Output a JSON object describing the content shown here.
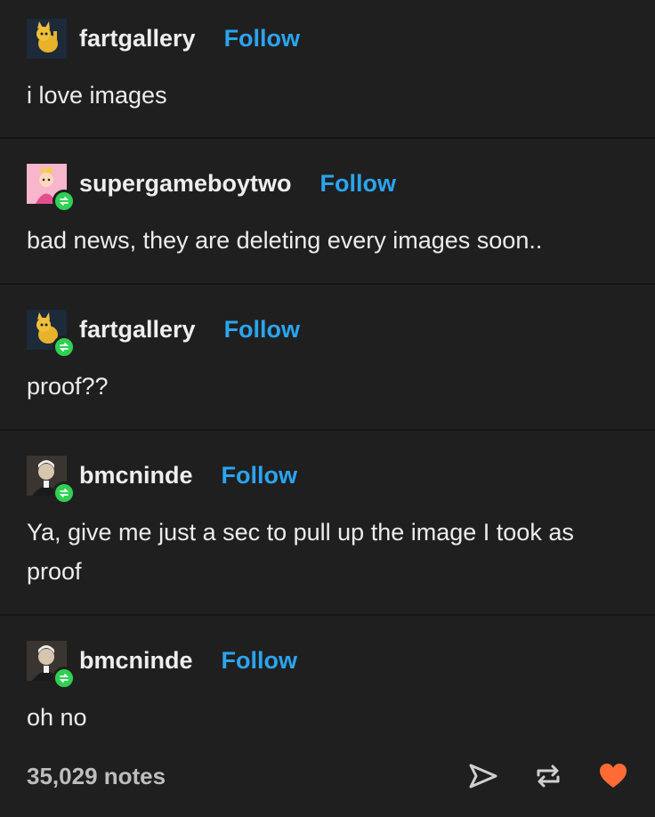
{
  "posts": [
    {
      "username": "fartgallery",
      "follow_label": "Follow",
      "text": "i love images",
      "avatar": "cat-avatar",
      "reblog": false
    },
    {
      "username": "supergameboytwo",
      "follow_label": "Follow",
      "text": "bad news, they are deleting every images soon..",
      "avatar": "princess-avatar",
      "reblog": true
    },
    {
      "username": "fartgallery",
      "follow_label": "Follow",
      "text": "proof??",
      "avatar": "cat-avatar",
      "reblog": true
    },
    {
      "username": "bmcninde",
      "follow_label": "Follow",
      "text": "Ya, give me just a sec to pull up the image I took as proof",
      "avatar": "portrait-avatar",
      "reblog": true
    },
    {
      "username": "bmcninde",
      "follow_label": "Follow",
      "text": "oh no",
      "avatar": "portrait-avatar",
      "reblog": true
    }
  ],
  "footer": {
    "notes": "35,029 notes",
    "icons": [
      "share-icon",
      "reblog-icon",
      "like-heart-icon"
    ],
    "like_color": "#ff6b36"
  },
  "colors": {
    "background": "#1f1f1f",
    "link": "#2ba4ef",
    "reblog_badge": "#2fd153"
  }
}
